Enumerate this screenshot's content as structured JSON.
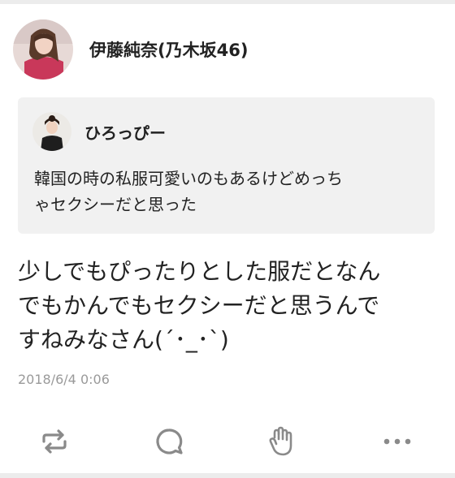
{
  "post": {
    "author_name": "伊藤純奈(乃木坂46)",
    "body_lines": [
      "少しでもぴったりとした服だとなん",
      "でもかんでもセクシーだと思うんで",
      "すねみなさん(´･_･`)"
    ],
    "timestamp": "2018/6/4 0:06"
  },
  "quoted": {
    "author_name": "ひろっぴー",
    "body_lines": [
      "韓国の時の私服可愛いのもあるけどめっち",
      "ゃセクシーだと思った"
    ]
  },
  "actions": [
    {
      "name": "repost",
      "icon": "repost-icon"
    },
    {
      "name": "reply",
      "icon": "speech-bubble-icon"
    },
    {
      "name": "applause",
      "icon": "clapping-hands-icon"
    },
    {
      "name": "more",
      "icon": "more-dots-icon"
    }
  ],
  "colors": {
    "text": "#222222",
    "meta": "#9a9a9a",
    "quote_bg": "#f1f1f1",
    "icon": "#8a8a8a"
  }
}
